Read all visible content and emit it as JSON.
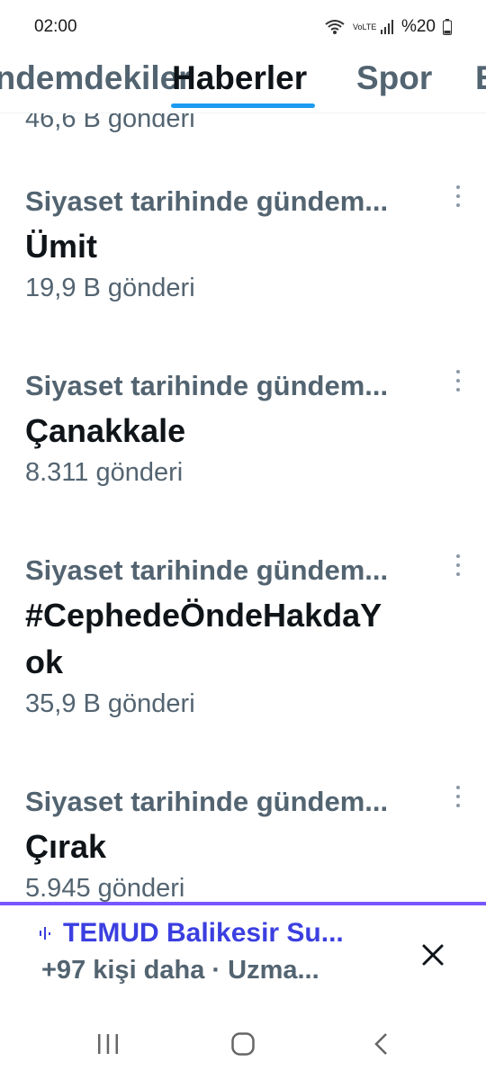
{
  "status_bar": {
    "time": "02:00",
    "battery": "%20",
    "network": "VoLTE"
  },
  "tabs": [
    {
      "label": "ündemdekiler",
      "active": false
    },
    {
      "label": "Haberler",
      "active": true
    },
    {
      "label": "Spor",
      "active": false
    },
    {
      "label": "E",
      "active": false
    }
  ],
  "feed": {
    "partial_top_count": "46,6 B gönderi",
    "items": [
      {
        "category": "Siyaset tarihinde gündem...",
        "title": "Ümit",
        "count": "19,9 B gönderi"
      },
      {
        "category": "Siyaset tarihinde gündem...",
        "title": "Çanakkale",
        "count": "8.311 gönderi"
      },
      {
        "category": "Siyaset tarihinde gündem...",
        "title_line1": "#CephedeÖndeHakdaY",
        "title_line2": "ok",
        "count": "35,9 B gönderi"
      },
      {
        "category": "Siyaset tarihinde gündem...",
        "title": "Çırak",
        "count": "5.945 gönderi"
      }
    ]
  },
  "banner": {
    "title": "TEMUD Balikesir Su...",
    "subtitle": "+97 kişi daha · Uzma...",
    "accent_color": "#7856ff"
  },
  "nav": [
    "recent-apps-icon",
    "home-icon",
    "back-icon"
  ]
}
